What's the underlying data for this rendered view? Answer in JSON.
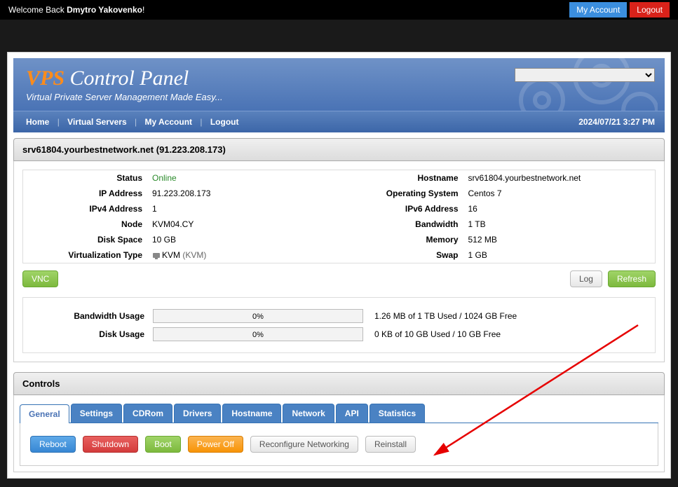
{
  "topbar": {
    "welcome_prefix": "Welcome Back ",
    "username": "Dmytro Yakovenko",
    "welcome_suffix": "!",
    "my_account": "My Account",
    "logout": "Logout"
  },
  "header": {
    "title_vps": "VPS",
    "title_rest": " Control Panel",
    "tagline": "Virtual Private Server Management Made Easy..."
  },
  "nav": {
    "home": "Home",
    "vs": "Virtual Servers",
    "account": "My Account",
    "logout": "Logout",
    "datetime": "2024/07/21 3:27 PM"
  },
  "server": {
    "title": "srv61804.yourbestnetwork.net (91.223.208.173)"
  },
  "info": {
    "labels": {
      "status": "Status",
      "ip": "IP Address",
      "ipv4": "IPv4 Address",
      "node": "Node",
      "disk": "Disk Space",
      "virt": "Virtualization Type",
      "hostname": "Hostname",
      "os": "Operating System",
      "ipv6": "IPv6 Address",
      "bw": "Bandwidth",
      "mem": "Memory",
      "swap": "Swap"
    },
    "values": {
      "status": "Online",
      "ip": "91.223.208.173",
      "ipv4": "1",
      "node": "KVM04.CY",
      "disk": "10 GB",
      "virt_name": "KVM",
      "virt_paren": "(KVM)",
      "hostname": "srv61804.yourbestnetwork.net",
      "os": "Centos 7",
      "ipv6": "16",
      "bw": "1 TB",
      "mem": "512 MB",
      "swap": "1 GB"
    }
  },
  "buttons": {
    "vnc": "VNC",
    "log": "Log",
    "refresh": "Refresh"
  },
  "usage": {
    "bw_label": "Bandwidth Usage",
    "bw_pct": "0%",
    "bw_text": "1.26 MB of 1 TB Used / 1024 GB Free",
    "disk_label": "Disk Usage",
    "disk_pct": "0%",
    "disk_text": "0 KB of 10 GB Used / 10 GB Free"
  },
  "controls": {
    "title": "Controls",
    "tabs": {
      "general": "General",
      "settings": "Settings",
      "cdrom": "CDRom",
      "drivers": "Drivers",
      "hostname": "Hostname",
      "network": "Network",
      "api": "API",
      "statistics": "Statistics"
    },
    "buttons": {
      "reboot": "Reboot",
      "shutdown": "Shutdown",
      "boot": "Boot",
      "poweroff": "Power Off",
      "reconfig": "Reconfigure Networking",
      "reinstall": "Reinstall"
    }
  }
}
